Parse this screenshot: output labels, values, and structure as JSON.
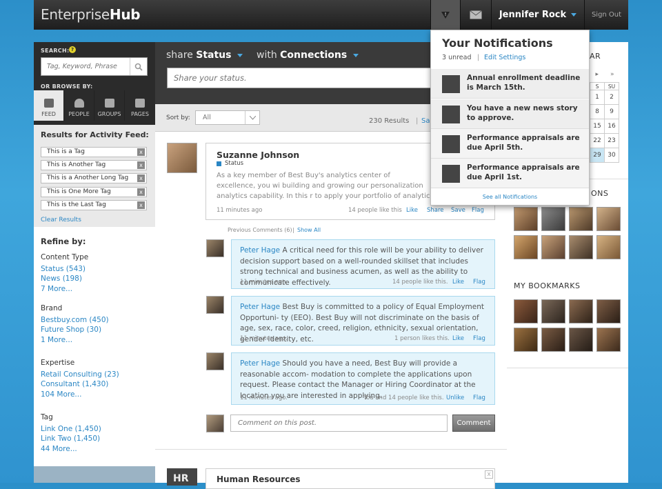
{
  "header": {
    "logo_a": "Enterprise",
    "logo_b": "Hub",
    "user": "Jennifer Rock",
    "signout": "Sign Out"
  },
  "left": {
    "search_label": "SEARCH:",
    "search_placeholder": "Tag, Keyword, Phrase",
    "browse_label": "OR BROWSE BY:",
    "tabs": [
      "FEED",
      "PEOPLE",
      "GROUPS",
      "PAGES"
    ],
    "results_title": "Results for Activity Feed:",
    "tags": [
      "This is a Tag",
      "This is Another Tag",
      "This is a Another Long Tag",
      "This is One More Tag",
      "This is the Last Tag"
    ],
    "clear": "Clear Results",
    "refine": "Refine by:",
    "groups": [
      {
        "h": "Content Type",
        "items": [
          "Status (543)",
          "News (198)",
          "7 More..."
        ]
      },
      {
        "h": "Brand",
        "items": [
          "Bestbuy.com (450)",
          "Future Shop (30)",
          "1 More..."
        ]
      },
      {
        "h": "Expertise",
        "items": [
          "Retail Consulting (23)",
          "Consultant (1,430)",
          "104 More..."
        ]
      },
      {
        "h": "Tag",
        "items": [
          "Link One (1,450)",
          "Link Two (1,450)",
          "44 More..."
        ]
      }
    ]
  },
  "center": {
    "share_a": "share",
    "share_b": "Status",
    "with_a": "with",
    "with_b": "Connections",
    "status_placeholder": "Share your status.",
    "sort_label": "Sort by:",
    "sort_value": "All",
    "results": "230 Results",
    "save_partial": "Sa",
    "post": {
      "name": "Suzanne Johnson",
      "type": "Status",
      "text": "As a key member of Best Buy's analytics center of excellence, you wi building and growing our personalization analytics capability. In this r to apply your portfolio of analytic strengths and well healed consultin",
      "time": "11 minutes ago",
      "likes": "14 people like this",
      "like": "Like",
      "share": "Share",
      "save": "Save",
      "flag": "Flag"
    },
    "prev": "Previous Comments (6)",
    "showall": "Show All",
    "comments": [
      {
        "name": "Peter Hage",
        "text": "A critical need for this role will be your ability to deliver decision support based on a well-rounded skillset that includes strong technical and business acumen, as well as the ability to communicate effectively.",
        "time": "11 minutes ago.",
        "likes": "14 people like this.",
        "like": "Like",
        "flag": "Flag"
      },
      {
        "name": "Peter Hage",
        "text": "Best Buy is committed to a policy of Equal Employment Opportuni- ty (EEO). Best Buy will not discriminate on the basis of age, sex, race, color, creed, religion, ethnicity, sexual orientation, gender identity, etc.",
        "time": "11 minutes ago.",
        "likes": "1 person likes this.",
        "like": "Like",
        "flag": "Flag"
      },
      {
        "name": "Peter Hage",
        "text": "Should you have a need, Best Buy will provide a reasonable accom- modation to complete the applications upon request. Please contact the Manager or Hiring Coordinator at the location you are interested in applying.",
        "time": "11 minutes ago.",
        "likes": "You and 14 people like this.",
        "like": "Unlike",
        "flag": "Flag"
      }
    ],
    "comment_placeholder": "Comment on this post.",
    "comment_btn": "Comment",
    "next_badge": "HR",
    "next_name": "Human Resources"
  },
  "notif": {
    "title": "Your Notifications",
    "unread": "3 unread",
    "edit": "Edit Settings",
    "items": [
      "Annual enrollment deadline is March 15th.",
      "You have a  new news story to approve.",
      "Performance appraisals are due April 5th.",
      "Performance appraisals are due April 1st."
    ],
    "seeall": "See all Notifications"
  },
  "right": {
    "cal_partial": "AR",
    "cal_head": [
      "S",
      "SU"
    ],
    "cal_rows": [
      [
        "1",
        "2"
      ],
      [
        "8",
        "9"
      ],
      [
        "15",
        "16"
      ],
      [
        "22",
        "23"
      ],
      [
        "29",
        "30"
      ]
    ],
    "conn_partial": "ONS",
    "bookmarks": "MY BOOKMARKS"
  },
  "colors": {
    "accent": "#2a86c4",
    "header": "#2a2a2a",
    "comment_bg": "#e4f4fb"
  }
}
